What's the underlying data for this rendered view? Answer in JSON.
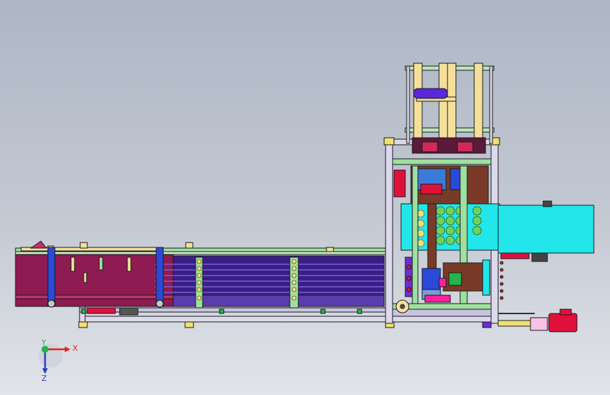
{
  "triad": {
    "x_label": "X",
    "y_label": "Y",
    "z_label": "Z",
    "x_color": "#e8221e",
    "y_color": "#23b44a",
    "z_color": "#2c3fbf"
  },
  "colors": {
    "frame": "#dcd9ec",
    "frame_edge": "#222222",
    "conveyor_body": "#8e1b52",
    "conveyor_band": "#4a2a8c",
    "rail_green": "#9fe0a0",
    "cyan_box": "#22e6ea",
    "motor_red": "#e0103c",
    "upright_yellow": "#f4e09a",
    "pink": "#ff1fa0",
    "blue_cyl": "#5a28d8"
  }
}
